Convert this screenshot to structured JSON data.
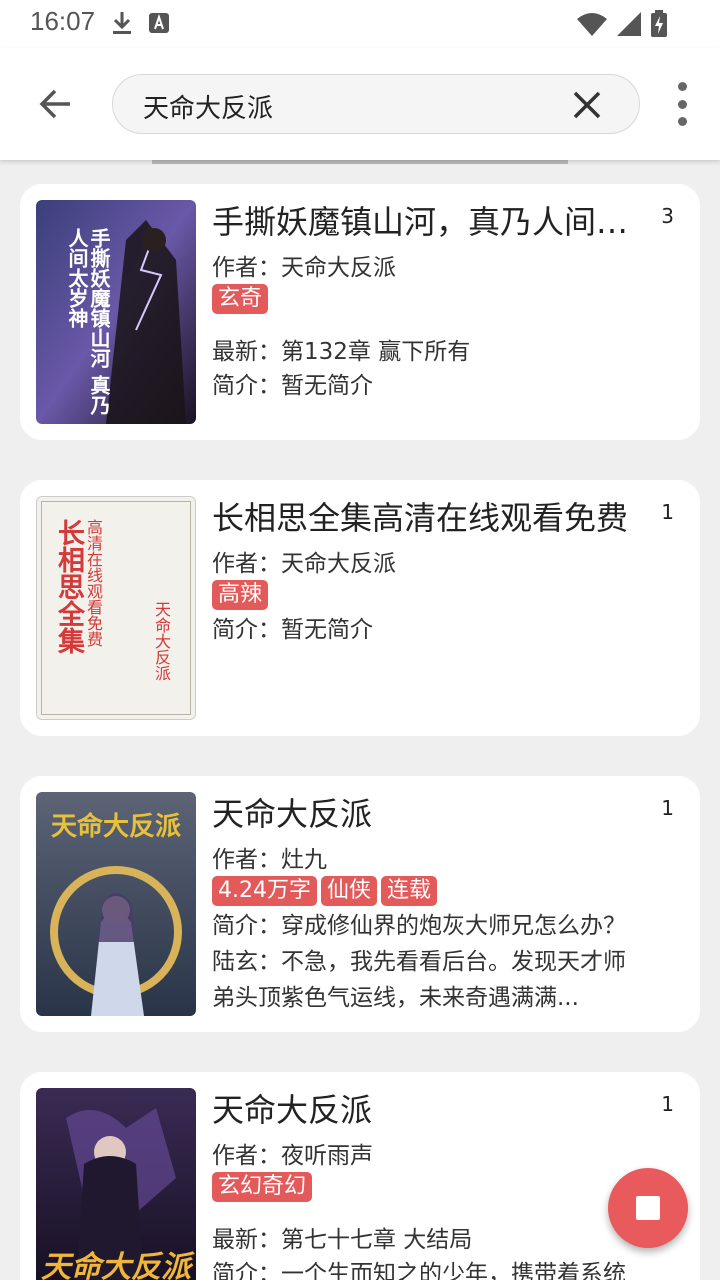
{
  "status_bar": {
    "time": "16:07",
    "icons": [
      "download-icon",
      "text-a-icon",
      "wifi-icon",
      "signal-icon",
      "battery-charging-icon"
    ]
  },
  "search": {
    "query": "天命大反派"
  },
  "colors": {
    "tag_bg": "#e25a5a",
    "fab_bg": "#e85a5c"
  },
  "results": [
    {
      "title": "手撕妖魔镇山河，真乃人间太岁神",
      "count": "3",
      "author": "作者：天命大反派",
      "tags": [
        "玄奇"
      ],
      "latest": "最新：第132章 赢下所有",
      "intro": "简介：暂无简介",
      "cover_text": "手撕妖魔镇山河 真乃人间太岁神"
    },
    {
      "title": "长相思全集高清在线观看免费",
      "count": "1",
      "author": "作者：天命大反派",
      "tags": [
        "高辣"
      ],
      "intro": "简介：暂无简介",
      "cover_big": "长相思全集",
      "cover_sub": "高清在线观看免费",
      "cover_author": "天命大反派"
    },
    {
      "title": "天命大反派",
      "count": "1",
      "author": "作者：灶九",
      "tags": [
        "4.24万字",
        "仙侠",
        "连载"
      ],
      "intro": "简介：穿成修仙界的炮灰大师兄怎么办？陆玄：不急，我先看看后台。发现天才师弟头顶紫色气运线，未来奇遇满满...",
      "cover_text": "天命大反派"
    },
    {
      "title": "天命大反派",
      "count": "1",
      "author": "作者：夜听雨声",
      "tags": [
        "玄幻奇幻"
      ],
      "latest": "最新：第七十七章 大结局",
      "intro": "简介：一个生而知之的少年，携带着系统",
      "cover_text": "天命大反派"
    }
  ]
}
